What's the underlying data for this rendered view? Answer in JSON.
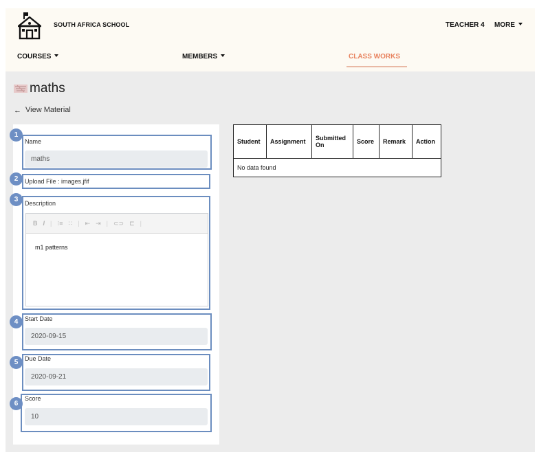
{
  "header": {
    "school_name": "SOUTH AFRICA SCHOOL",
    "user": "TEACHER 4",
    "more": "MORE",
    "logo_icon": "school-building-icon"
  },
  "nav": {
    "courses": "COURSES",
    "members": "MEMBERS",
    "classworks": "CLASS WORKS",
    "active": "CLASS WORKS",
    "active_color": "#e8825e"
  },
  "page": {
    "title": "maths",
    "back_label": "View Material"
  },
  "form": {
    "name_label": "Name",
    "name_value": "maths",
    "upload_label": "Upload File : images.jfif",
    "description_label": "Description",
    "description_value": "m1 patterns",
    "toolbar_icons": [
      "bold-icon",
      "italic-icon",
      "ordered-list-icon",
      "unordered-list-icon",
      "outdent-icon",
      "indent-icon",
      "link-icon",
      "unlink-icon"
    ],
    "toolbar_glyphs": {
      "bold": "B",
      "italic": "I",
      "ol": "⁝≡",
      "ul": "∷",
      "outdent": "⇤",
      "indent": "⇥",
      "link": "⊂⊃",
      "unlink": "⊏"
    },
    "start_date_label": "Start Date",
    "start_date_value": "2020-09-15",
    "due_date_label": "Due Date",
    "due_date_value": "2020-09-21",
    "score_label": "Score",
    "score_value": "10"
  },
  "annotations": [
    "1",
    "2",
    "3",
    "4",
    "5",
    "6"
  ],
  "annotation_color": "#6e8fc4",
  "table": {
    "columns": [
      "Student",
      "Assignment",
      "Submitted On",
      "Score",
      "Remark",
      "Action"
    ],
    "empty_text": "No data found"
  }
}
